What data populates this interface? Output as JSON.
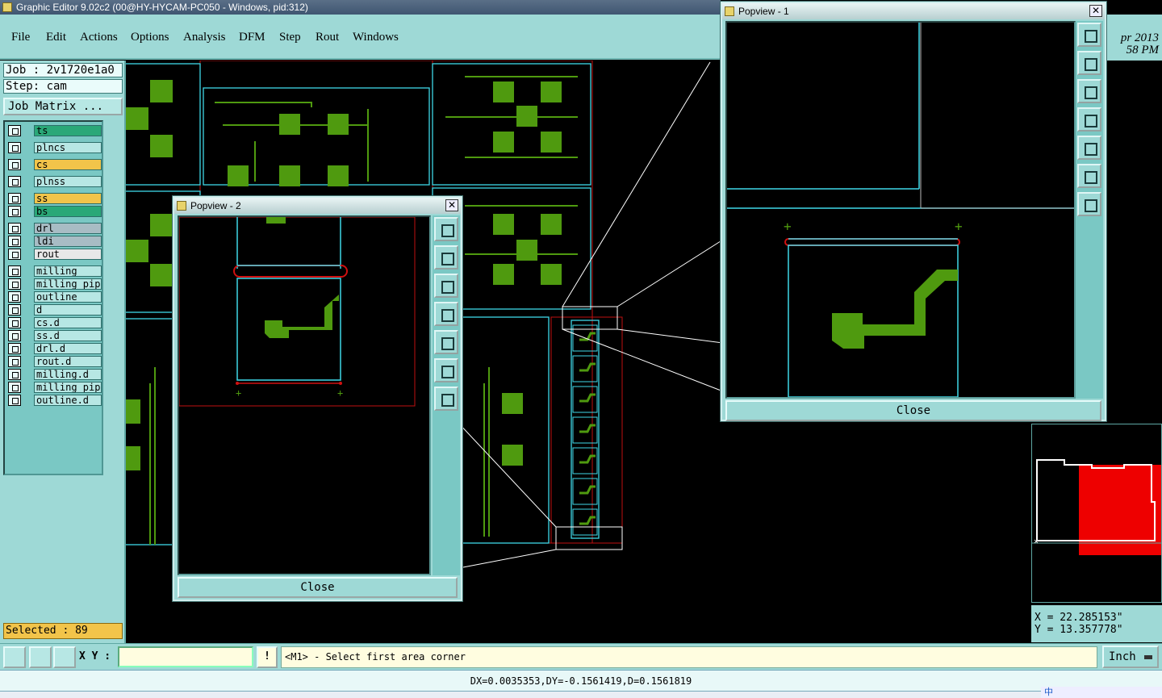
{
  "window": {
    "title": "Graphic Editor 9.02c2 (00@HY-HYCAM-PC050 - Windows, pid:312)"
  },
  "menu": {
    "items": [
      {
        "label": "File"
      },
      {
        "label": "Edit"
      },
      {
        "label": "Actions"
      },
      {
        "label": "Options"
      },
      {
        "label": "Analysis"
      },
      {
        "label": "DFM"
      },
      {
        "label": "Step"
      },
      {
        "label": "Rout"
      },
      {
        "label": "Windows"
      }
    ]
  },
  "header": {
    "date_line1": "pr 2013",
    "date_line2": "58 PM"
  },
  "job": {
    "job_line": "Job : 2v1720e1a0",
    "step_line": "Step: cam",
    "matrix_button": "Job Matrix ..."
  },
  "layers": [
    {
      "name": "ts",
      "color": "#2aa878"
    },
    {
      "name": "plncs",
      "color": "#b7e7e4"
    },
    {
      "name": "cs",
      "color": "#f2c44a"
    },
    {
      "name": "plnss",
      "color": "#b7e7e4"
    },
    {
      "name": "ss",
      "color": "#f2c44a"
    },
    {
      "name": "bs",
      "color": "#2aa878"
    },
    {
      "name": "drl",
      "color": "#a8bcc4"
    },
    {
      "name": "ldi",
      "color": "#a8bcc4"
    },
    {
      "name": "rout",
      "color": "#e8e8e8"
    },
    {
      "name": "milling",
      "color": "#b7e7e4"
    },
    {
      "name": "milling_pips",
      "color": "#b7e7e4"
    },
    {
      "name": "outline",
      "color": "#b7e7e4"
    },
    {
      "name": "d",
      "color": "#b7e7e4"
    },
    {
      "name": "cs.d",
      "color": "#b7e7e4"
    },
    {
      "name": "ss.d",
      "color": "#b7e7e4"
    },
    {
      "name": "drl.d",
      "color": "#b7e7e4"
    },
    {
      "name": "rout.d",
      "color": "#b7e7e4"
    },
    {
      "name": "milling.d",
      "color": "#b7e7e4"
    },
    {
      "name": "milling_pips",
      "color": "#b7e7e4"
    },
    {
      "name": "outline.d",
      "color": "#b7e7e4"
    }
  ],
  "selection": {
    "label": "Selected : 89"
  },
  "popview2": {
    "title": "Popview - 2",
    "close_label": "Close"
  },
  "popview1": {
    "title": "Popview - 1",
    "close_label": "Close"
  },
  "coords": {
    "x": "X = 22.285153\"",
    "y": "Y = 13.357778\""
  },
  "command": {
    "xy_label": "X Y :",
    "xy_value": "",
    "bang": "!",
    "prompt": "<M1> - Select first area corner",
    "unit": "Inch"
  },
  "status": {
    "text": "DX=0.0035353,DY=-0.1561419,D=0.1561819"
  },
  "tray": {
    "ime": "中"
  },
  "colors": {
    "accent": "#9ed9d6",
    "copper": "#4f9a0f",
    "outline": "#3fd8e8",
    "profile": "#d01010"
  }
}
